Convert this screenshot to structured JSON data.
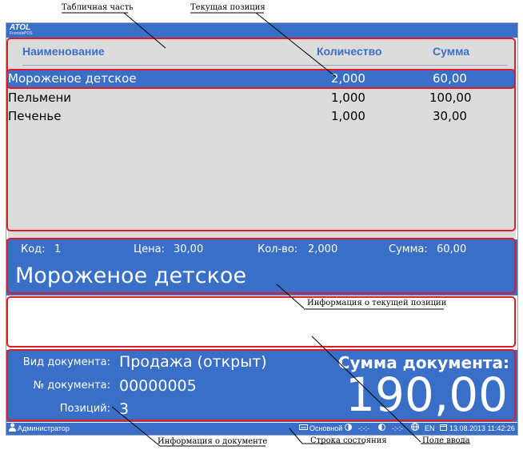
{
  "app": {
    "logo": "ATOL",
    "logo_sub": "FrontolxPOS"
  },
  "table": {
    "headers": {
      "name": "Наименование",
      "qty": "Количество",
      "sum": "Сумма"
    },
    "rows": [
      {
        "name": "Мороженое детское",
        "qty": "2,000",
        "sum": "60,00",
        "selected": true
      },
      {
        "name": "Пельмени",
        "qty": "1,000",
        "sum": "100,00",
        "selected": false
      },
      {
        "name": "Печенье",
        "qty": "1,000",
        "sum": "30,00",
        "selected": false
      }
    ]
  },
  "current": {
    "code_label": "Код:",
    "code": "1",
    "price_label": "Цена:",
    "price": "30,00",
    "qty_label": "Кол-во:",
    "qty": "2,000",
    "sum_label": "Сумма:",
    "sum": "60,00",
    "name": "Мороженое детское"
  },
  "input": {
    "value": ""
  },
  "document": {
    "type_label": "Вид документа:",
    "type": "Продажа (открыт)",
    "num_label": "№ документа:",
    "num": "00000005",
    "pos_label": "Позиций:",
    "pos": "3",
    "sum_label": "Сумма документа:",
    "sum": "190,00"
  },
  "status": {
    "user": "Администратор",
    "layout": "Основной",
    "dots1": "-:-:-",
    "dots2": "-:-:-",
    "lang": "EN",
    "datetime": "13.08.2013 11:42:26"
  },
  "annotations": {
    "table_part": "Табличная часть",
    "current_position": "Текущая позиция",
    "current_info": "Информация о текущей позиции",
    "doc_info": "Информация о документе",
    "status_bar": "Строка состояния",
    "input_field": "Поле ввода"
  },
  "colors": {
    "accent": "#3a6fc8",
    "table_bg": "#dcdcdc",
    "highlight": "#e01c2a"
  }
}
